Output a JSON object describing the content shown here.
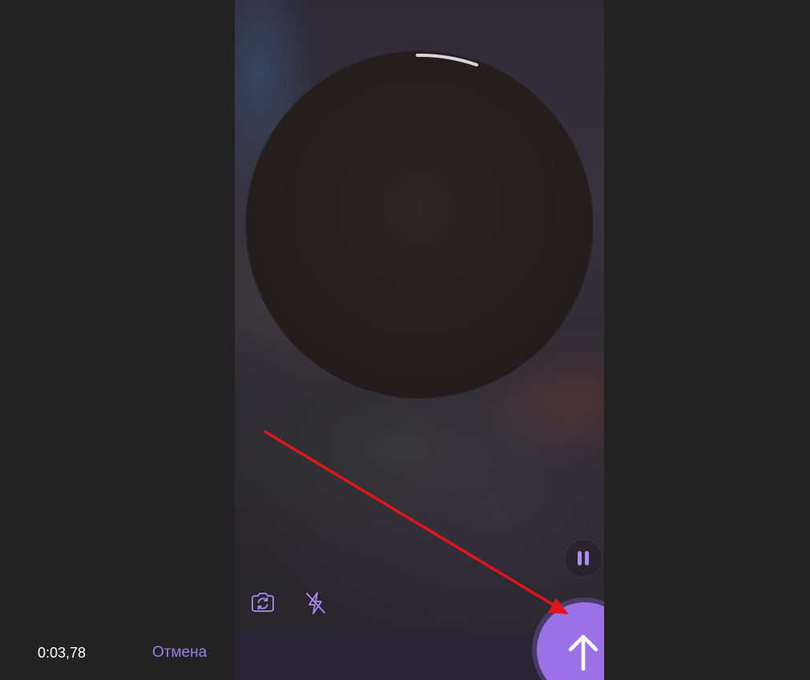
{
  "recording": {
    "timer": "0:03,78",
    "cancel_label": "Отмена"
  },
  "icons": {
    "pause": "pause-icon",
    "camera_switch": "camera-switch-icon",
    "flash_off": "flash-off-icon",
    "send": "arrow-up-icon"
  },
  "colors": {
    "accent": "#9b72e6",
    "cancel_text": "#9b7ee8",
    "bottom_bar": "#2a2534",
    "annotation_arrow": "#e0141b"
  }
}
